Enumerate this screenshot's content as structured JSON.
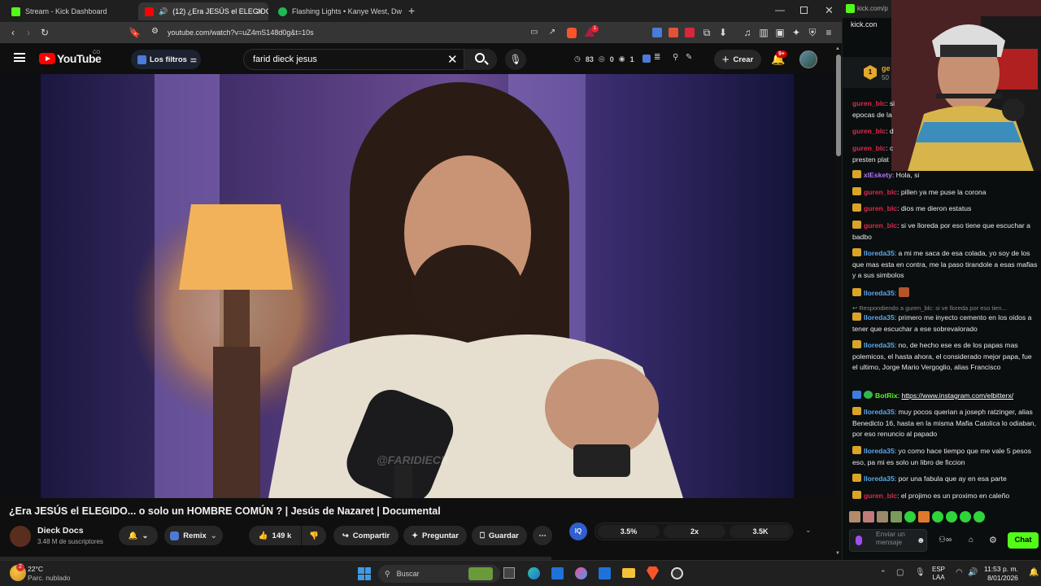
{
  "browser": {
    "tabs": [
      {
        "label": "Stream - Kick Dashboard",
        "color": "#53fc18"
      },
      {
        "label": "(12) ¿Era JESÚS el ELEGIDO...",
        "color": "#ff0000"
      },
      {
        "label": "Flashing Lights • Kanye West, Dw",
        "color": "#1db954"
      }
    ],
    "url": "youtube.com/watch?v=uZ4mS148d0g&t=10s",
    "brave_count": "1"
  },
  "youtube": {
    "logo": "YouTube",
    "region": "CO",
    "filters_label": "Los filtros",
    "search_value": "farid dieck jesus",
    "ext_counts": {
      "a": "83",
      "b": "0",
      "c": "1"
    },
    "create_label": "Crear",
    "notif_badge": "9+",
    "watermark": "@FARIDIECK"
  },
  "video": {
    "title": "¿Era JESÚS el ELEGIDO... o solo un HOMBRE COMÚN ? | Jesús de Nazaret | Documental",
    "channel": "Dieck Docs",
    "subscribers": "3.48 M de suscriptores",
    "remix": "Remix",
    "likes": "149 k",
    "share": "Compartir",
    "ask": "Preguntar",
    "save": "Guardar",
    "stats": [
      "3.5%",
      "2x",
      "3.5K"
    ]
  },
  "chat": {
    "header": "kick.com/p",
    "header2": "kick.con",
    "gift_label": "ge",
    "gift_sub": "50",
    "messages": [
      {
        "user": "guren_blc",
        "text": ": si",
        "color": "red"
      },
      {
        "user": "",
        "text": "epocas de la",
        "color": "none"
      },
      {
        "user": "guren_blc",
        "text": ": d",
        "color": "red"
      },
      {
        "user": "guren_blc",
        "text": ": c",
        "color": "red"
      },
      {
        "user": "",
        "text": "presten plat",
        "color": "none"
      },
      {
        "user": "xlEskety",
        "text": ": Hola, si",
        "color": "purple"
      },
      {
        "user": "guren_blc",
        "text": ": pillen ya me puse la corona",
        "color": "red"
      },
      {
        "user": "guren_blc",
        "text": ": dios me dieron estatus",
        "color": "red"
      },
      {
        "user": "guren_blc",
        "text": ": si ve lloreda por eso tiene que escuchar a badbo",
        "color": "red"
      },
      {
        "user": "lloreda35",
        "text": ": a mi me saca de esa colada, yo soy de los que mas esta en contra, me la paso tirandole a esas mafias y a sus simbolos",
        "color": "blue"
      },
      {
        "user": "lloreda35",
        "text": ": ",
        "color": "blue"
      },
      {
        "user": "",
        "text": "Respondiendo a guren_blc: si ve lloreda por eso tien...",
        "color": "reply"
      },
      {
        "user": "lloreda35",
        "text": ": primero me inyecto cemento en los oidos a tener que escuchar a ese sobrevalorado",
        "color": "blue"
      },
      {
        "user": "lloreda35",
        "text": ": no, de hecho ese es de los papas mas polemicos, el hasta ahora, el considerado mejor papa, fue el ultimo, Jorge Mario Vergoglio, alias Francisco",
        "color": "blue"
      },
      {
        "user": "BotRix",
        "text": ": ",
        "link": "https://www.instagram.com/elbitterx/",
        "color": "green"
      },
      {
        "user": "lloreda35",
        "text": ": muy pocos querian a joseph ratzinger, alias Benedicto 16, hasta en la misma Mafia Catolica lo odiaban, por eso renuncio al papado",
        "color": "blue"
      },
      {
        "user": "lloreda35",
        "text": ": yo como hace tiempo que me vale 5 pesos eso, pa mi es solo un libro de ficcion",
        "color": "blue"
      },
      {
        "user": "lloreda35",
        "text": ": por una fabula que ay en esa parte",
        "color": "blue"
      },
      {
        "user": "guren_blc",
        "text": ": el projimo es un proximo en caleño",
        "color": "red"
      }
    ],
    "input_placeholder": "Enviar un mensaje",
    "chat_button": "Chat"
  },
  "taskbar": {
    "temp": "22°C",
    "weather": "Parc. nublado",
    "search": "Buscar",
    "lang1": "ESP",
    "lang2": "LAA",
    "time": "11:53 p. m.",
    "date": "8/01/2026",
    "weather_badge": "2"
  }
}
